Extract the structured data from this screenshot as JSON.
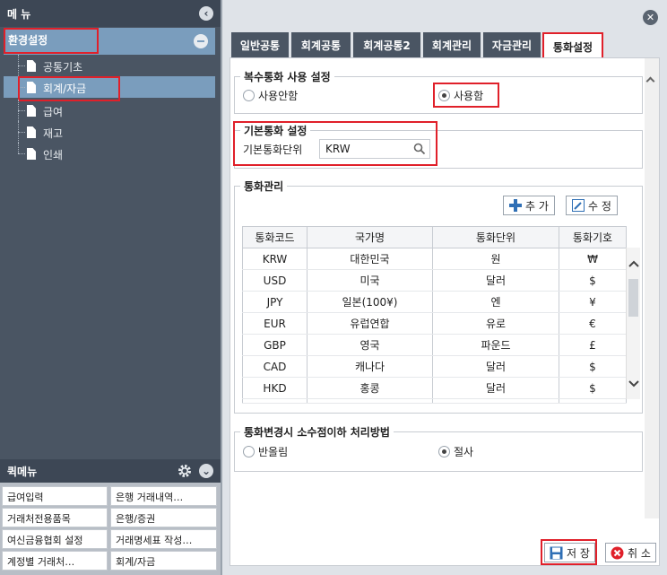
{
  "left": {
    "menu_title": "메 뉴",
    "tree_root": "환경설정",
    "tree_items": [
      "공통기초",
      "회계/자금",
      "급여",
      "재고",
      "인쇄"
    ],
    "selected_index": 1,
    "quick_title": "퀵메뉴",
    "quick_items": [
      [
        "급여입력",
        "은행 거래내역…"
      ],
      [
        "거래처전용품목",
        "은행/증권"
      ],
      [
        "여신금융협회 설정",
        "거래명세표 작성…"
      ],
      [
        "계정별 거래처…",
        "회계/자금"
      ]
    ]
  },
  "tabs": [
    "일반공통",
    "회계공통",
    "회계공통2",
    "회계관리",
    "자금관리",
    "통화설정"
  ],
  "active_tab": 5,
  "multi_currency": {
    "legend": "복수통화 사용 설정",
    "option_off": "사용안함",
    "option_on": "사용함",
    "selected": "option_on"
  },
  "base_currency": {
    "legend": "기본통화 설정",
    "label": "기본통화단위",
    "value": "KRW"
  },
  "currency_mgmt": {
    "legend": "통화관리",
    "add_label": "추 가",
    "edit_label": "수 정",
    "columns": [
      "통화코드",
      "국가명",
      "통화단위",
      "통화기호"
    ],
    "rows": [
      [
        "KRW",
        "대한민국",
        "원",
        "₩"
      ],
      [
        "USD",
        "미국",
        "달러",
        "$"
      ],
      [
        "JPY",
        "일본(100¥)",
        "엔",
        "¥"
      ],
      [
        "EUR",
        "유럽연합",
        "유로",
        "€"
      ],
      [
        "GBP",
        "영국",
        "파운드",
        "£"
      ],
      [
        "CAD",
        "캐나다",
        "달러",
        "$"
      ],
      [
        "HKD",
        "홍콩",
        "달러",
        "$"
      ]
    ]
  },
  "rounding": {
    "legend": "통화변경시 소수점이하 처리방법",
    "option_round": "반올림",
    "option_truncate": "절사",
    "selected": "option_truncate"
  },
  "footer": {
    "save_label": "저 장",
    "cancel_label": "취 소"
  }
}
